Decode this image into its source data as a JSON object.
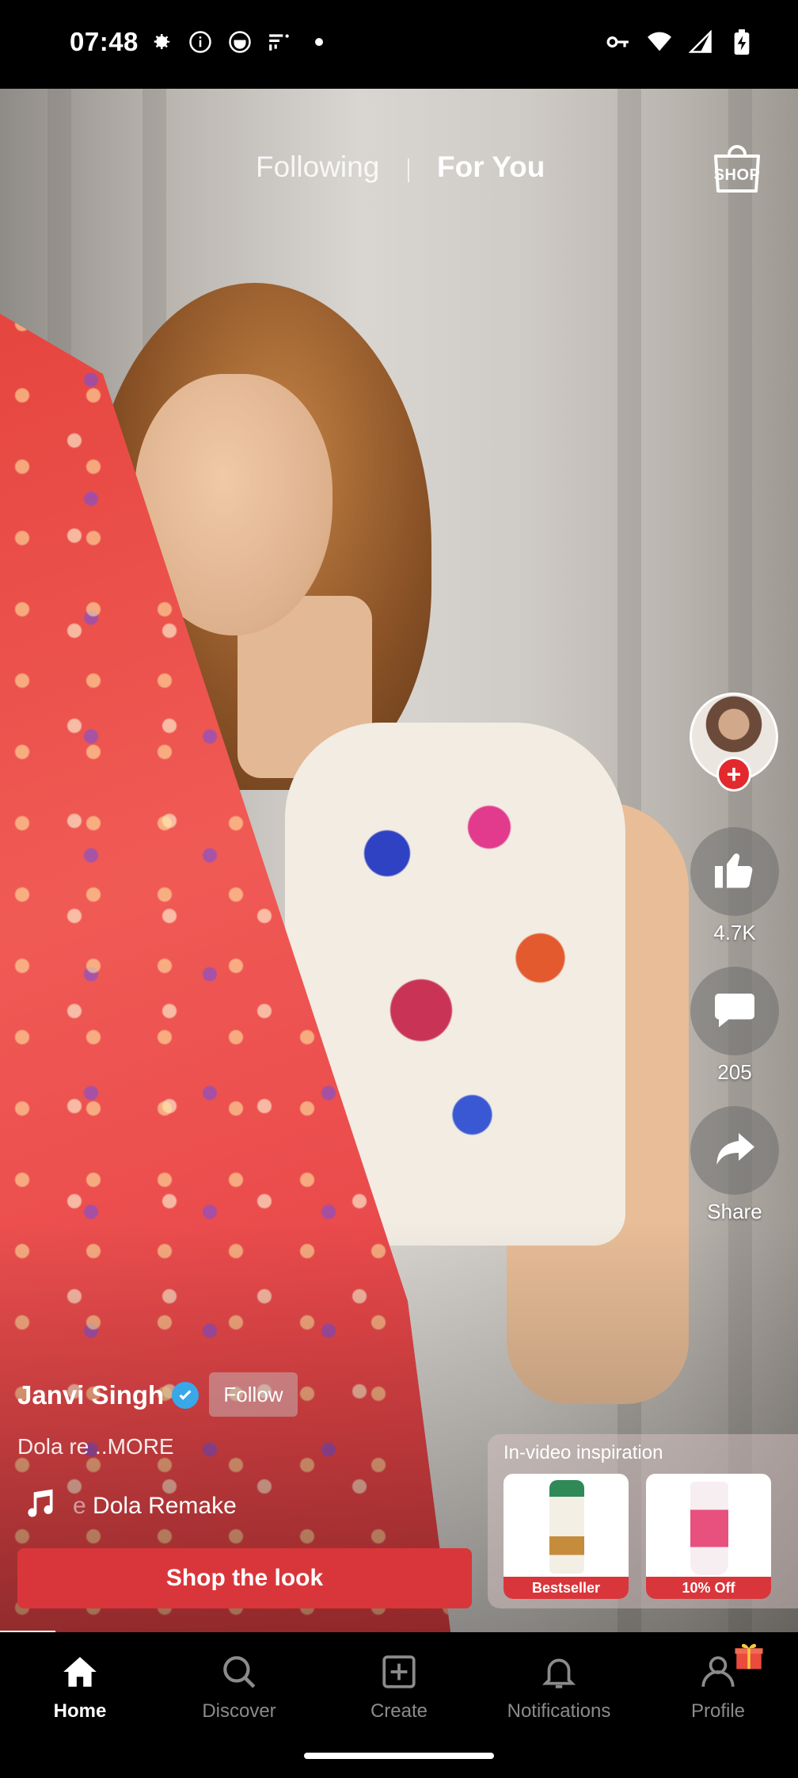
{
  "status_bar": {
    "time": "07:48",
    "left_icons": [
      "gear-icon",
      "info-icon",
      "app-icon",
      "signal-app-icon",
      "dot-icon"
    ],
    "right_icons": [
      "key-icon",
      "wifi-icon",
      "cell-signal-icon",
      "battery-charging-icon"
    ]
  },
  "top_tabs": {
    "following": "Following",
    "for_you": "For You",
    "shop": "SHOP"
  },
  "right_rail": {
    "likes": "4.7K",
    "comments": "205",
    "share": "Share"
  },
  "post": {
    "username": "Janvi Singh",
    "follow": "Follow",
    "caption": "Dola re ..MORE",
    "music_prefix": "e",
    "music_title": "Dola Remake",
    "shop_the_look": "Shop the look"
  },
  "inspiration": {
    "title": "In-video inspiration",
    "products": [
      {
        "badge": "Bestseller"
      },
      {
        "badge": "10% Off"
      }
    ]
  },
  "bottom_nav": {
    "items": [
      {
        "label": "Home",
        "icon": "home-icon",
        "active": true
      },
      {
        "label": "Discover",
        "icon": "search-icon"
      },
      {
        "label": "Create",
        "icon": "create-icon"
      },
      {
        "label": "Notifications",
        "icon": "bell-icon"
      },
      {
        "label": "Profile",
        "icon": "profile-icon"
      }
    ]
  },
  "colors": {
    "accent_red": "#d9363b",
    "verified_blue": "#39a7e8",
    "inactive_gray": "#8b8b8b"
  }
}
